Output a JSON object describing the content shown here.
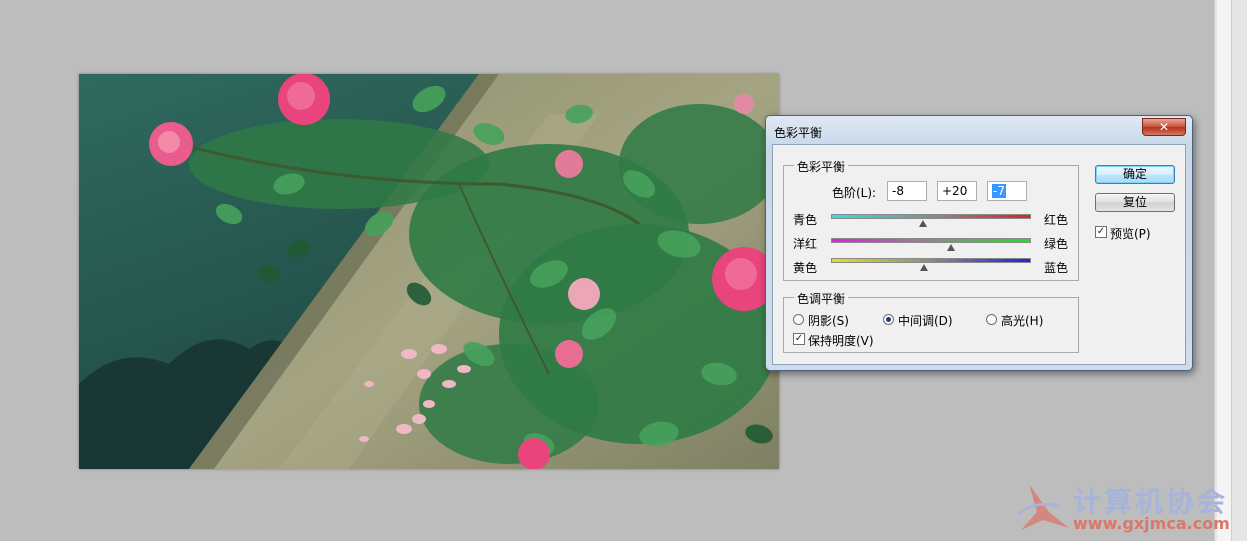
{
  "dialog": {
    "title": "色彩平衡",
    "close_glyph": "✕",
    "color_balance": {
      "legend": "色彩平衡",
      "levels_label": "色阶(L):",
      "levels": [
        "-8",
        "+20",
        "-7"
      ],
      "sliders": [
        {
          "left": "青色",
          "right": "红色",
          "value": -8,
          "min": -100,
          "max": 100,
          "gradient": [
            "#2fe0e0",
            "#e02020"
          ]
        },
        {
          "left": "洋红",
          "right": "绿色",
          "value": 20,
          "min": -100,
          "max": 100,
          "gradient": [
            "#e020e0",
            "#20e020"
          ]
        },
        {
          "left": "黄色",
          "right": "蓝色",
          "value": -7,
          "min": -100,
          "max": 100,
          "gradient": [
            "#e0e020",
            "#2020e0"
          ]
        }
      ]
    },
    "tone_balance": {
      "legend": "色调平衡",
      "options": [
        {
          "label": "阴影(S)",
          "selected": false
        },
        {
          "label": "中间调(D)",
          "selected": true
        },
        {
          "label": "高光(H)",
          "selected": false
        }
      ],
      "preserve_luminosity": {
        "label": "保持明度(V)",
        "checked": true
      }
    },
    "buttons": {
      "ok": "确定",
      "reset": "复位"
    },
    "preview": {
      "label": "预览(P)",
      "checked": true
    }
  },
  "watermark": {
    "title": "计算机协会",
    "url": "www.gxjmca.com"
  },
  "colors": {
    "canvas_background": "#bdbdbd",
    "photo_water": "#27584f",
    "photo_wall": "#9a9b78"
  }
}
